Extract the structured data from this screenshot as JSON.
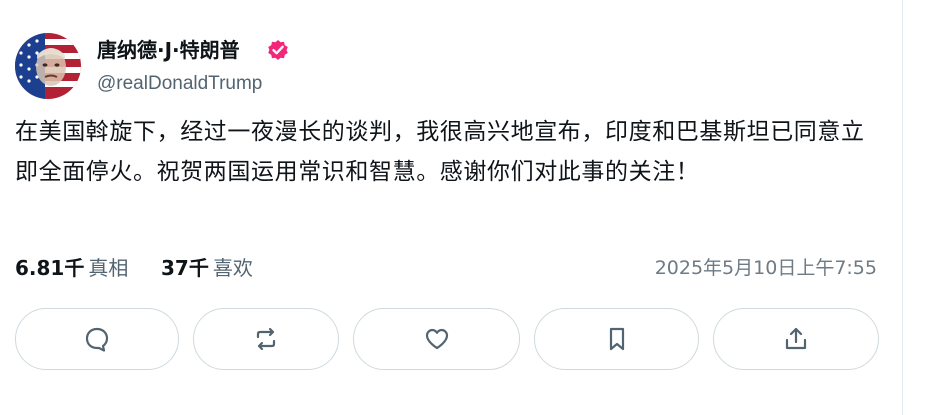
{
  "author": {
    "display_name": "唐纳德·J·特朗普",
    "handle": "@realDonaldTrump",
    "verified": true,
    "verified_badge_color": "#f4267a",
    "avatar_icon": "flag-portrait-avatar"
  },
  "post": {
    "text": "在美国斡旋下，经过一夜漫长的谈判，我很高兴地宣布，印度和巴基斯坦已同意立即全面停火。祝贺两国运用常识和智慧。感谢你们对此事的关注！"
  },
  "stats": {
    "views_count": "6.81千",
    "views_label": "真相",
    "likes_count": "37千",
    "likes_label": "喜欢",
    "timestamp": "2025年5月10日上午7:55"
  },
  "actions": [
    {
      "name": "reply-button",
      "icon": "comment-icon"
    },
    {
      "name": "repost-button",
      "icon": "repost-icon"
    },
    {
      "name": "like-button",
      "icon": "heart-icon"
    },
    {
      "name": "bookmark-button",
      "icon": "bookmark-icon"
    },
    {
      "name": "share-button",
      "icon": "share-icon"
    }
  ],
  "colors": {
    "text_primary": "#0f1419",
    "text_secondary": "#536471",
    "border": "#cfd9de"
  }
}
